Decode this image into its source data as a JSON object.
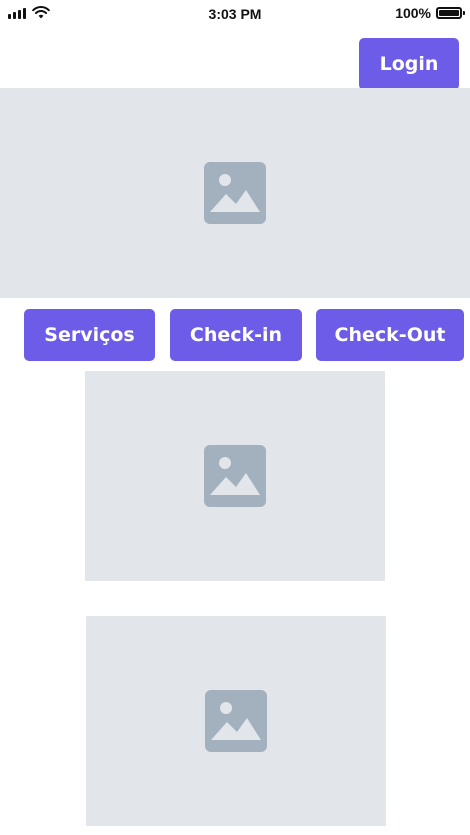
{
  "status_bar": {
    "time": "3:03 PM",
    "battery_percent": "100%",
    "battery_level": 1.0,
    "icons": [
      "signal-icon",
      "wifi-icon",
      "battery-icon"
    ]
  },
  "header": {
    "login_label": "Login"
  },
  "nav": {
    "buttons": [
      {
        "label": "Serviços"
      },
      {
        "label": "Check-in"
      },
      {
        "label": "Check-Out"
      }
    ]
  },
  "colors": {
    "accent": "#6c5ce7",
    "placeholder_bg": "#e2e6ea",
    "placeholder_icon": "#a3b1bf"
  },
  "images": {
    "icon": "image-placeholder-icon",
    "count": 3
  }
}
